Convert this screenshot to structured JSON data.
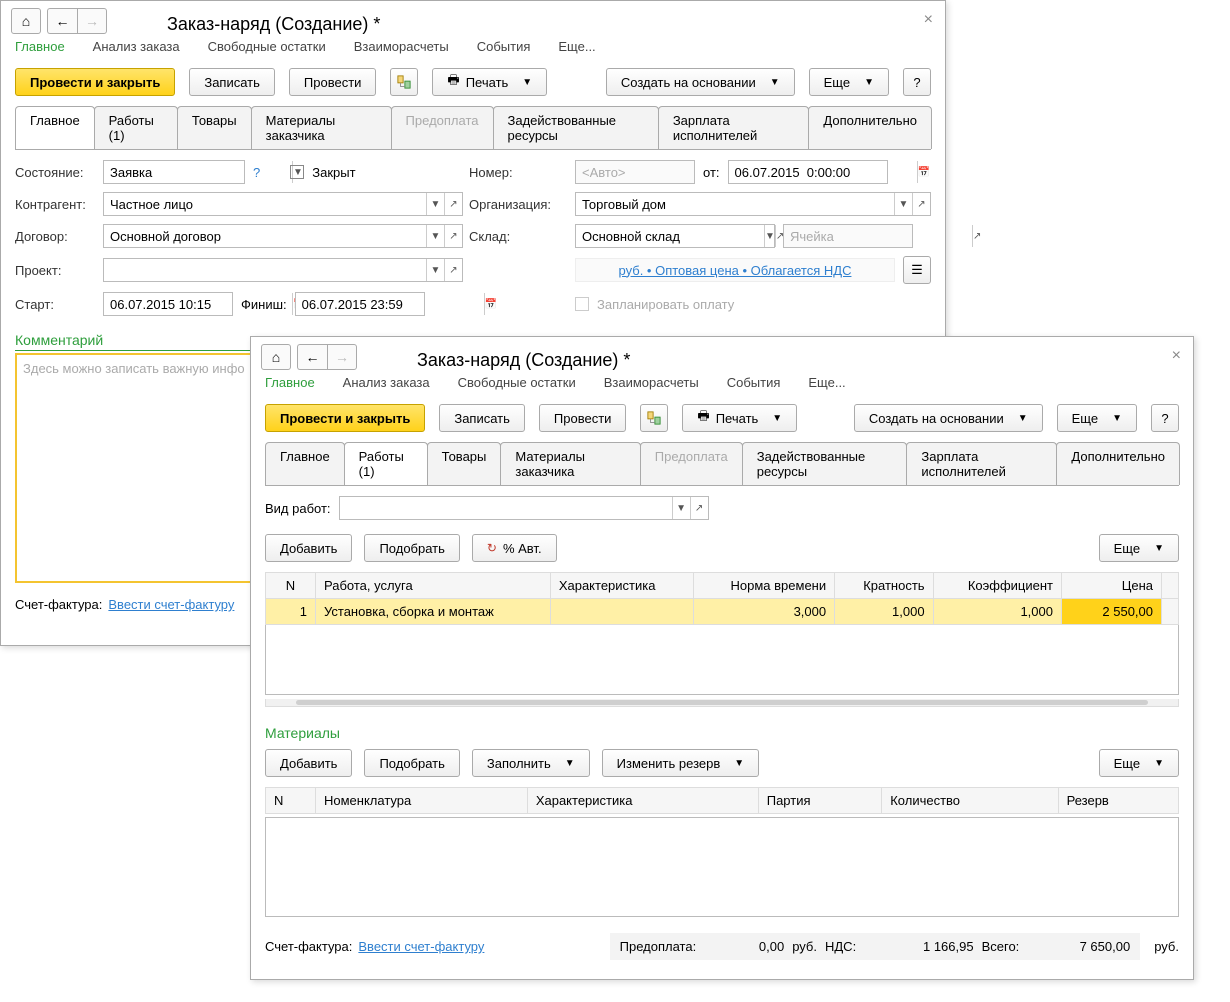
{
  "win1": {
    "title": "Заказ-наряд (Создание) *",
    "nav": {
      "main": "Главное",
      "analysis": "Анализ заказа",
      "free": "Свободные остатки",
      "settle": "Взаиморасчеты",
      "events": "События",
      "more": "Еще..."
    },
    "cmd": {
      "post_close": "Провести и закрыть",
      "write": "Записать",
      "post": "Провести",
      "print": "Печать",
      "create_on_base": "Создать на основании",
      "more": "Еще",
      "help": "?"
    },
    "tabs": {
      "main": "Главное",
      "works": "Работы (1)",
      "goods": "Товары",
      "customer_mats": "Материалы заказчика",
      "prepay": "Предоплата",
      "resources": "Задействованные ресурсы",
      "salary": "Зарплата исполнителей",
      "extra": "Дополнительно"
    },
    "form": {
      "state_lbl": "Состояние:",
      "state_val": "Заявка",
      "q": "?",
      "closed_lbl": "Закрыт",
      "number_lbl": "Номер:",
      "number_ph": "<Авто>",
      "from_lbl": "от:",
      "date_val": "06.07.2015  0:00:00",
      "contr_lbl": "Контрагент:",
      "contr_val": "Частное лицо",
      "org_lbl": "Организация:",
      "org_val": "Торговый дом",
      "agr_lbl": "Договор:",
      "agr_val": "Основной договор",
      "warehouse_lbl": "Склад:",
      "warehouse_val": "Основной склад",
      "cell_ph": "Ячейка",
      "project_lbl": "Проект:",
      "price_link": "руб. • Оптовая цена • Облагается НДС",
      "start_lbl": "Старт:",
      "start_val": "06.07.2015 10:15",
      "finish_lbl": "Финиш:",
      "finish_val": "06.07.2015 23:59",
      "plan_pay": "Запланировать оплату",
      "comment_title": "Комментарий",
      "comment_ph": "Здесь можно записать важную инфо"
    },
    "footer": {
      "invoice_lbl": "Счет-фактура:",
      "invoice_link": "Ввести счет-фактуру"
    }
  },
  "win2": {
    "title": "Заказ-наряд (Создание) *",
    "nav": {
      "main": "Главное",
      "analysis": "Анализ заказа",
      "free": "Свободные остатки",
      "settle": "Взаиморасчеты",
      "events": "События",
      "more": "Еще..."
    },
    "cmd": {
      "post_close": "Провести и закрыть",
      "write": "Записать",
      "post": "Провести",
      "print": "Печать",
      "create_on_base": "Создать на основании",
      "more": "Еще",
      "help": "?"
    },
    "tabs": {
      "main": "Главное",
      "works": "Работы (1)",
      "goods": "Товары",
      "customer_mats": "Материалы заказчика",
      "prepay": "Предоплата",
      "resources": "Задействованные ресурсы",
      "salary": "Зарплата исполнителей",
      "extra": "Дополнительно"
    },
    "work_type_lbl": "Вид работ:",
    "bar1": {
      "add": "Добавить",
      "pick": "Подобрать",
      "pct": "% Авт.",
      "more": "Еще"
    },
    "works_cols": {
      "n": "N",
      "work": "Работа, услуга",
      "char": "Характеристика",
      "norm": "Норма времени",
      "mult": "Кратность",
      "coef": "Коэффициент",
      "price": "Цена"
    },
    "works_row": {
      "n": "1",
      "name": "Установка, сборка и монтаж",
      "norm": "3,000",
      "mult": "1,000",
      "coef": "1,000",
      "price": "2 550,00"
    },
    "materials_title": "Материалы",
    "bar2": {
      "add": "Добавить",
      "pick": "Подобрать",
      "fill": "Заполнить",
      "reserve": "Изменить резерв",
      "more": "Еще"
    },
    "mat_cols": {
      "n": "N",
      "nom": "Номенклатура",
      "char": "Характеристика",
      "batch": "Партия",
      "qty": "Количество",
      "res": "Резерв"
    },
    "footer": {
      "invoice_lbl": "Счет-фактура:",
      "invoice_link": "Ввести счет-фактуру",
      "prepay_lbl": "Предоплата:",
      "prepay_val": "0,00",
      "currency": "руб.",
      "vat_lbl": "НДС:",
      "vat_val": "1 166,95",
      "total_lbl": "Всего:",
      "total_val": "7 650,00"
    }
  }
}
